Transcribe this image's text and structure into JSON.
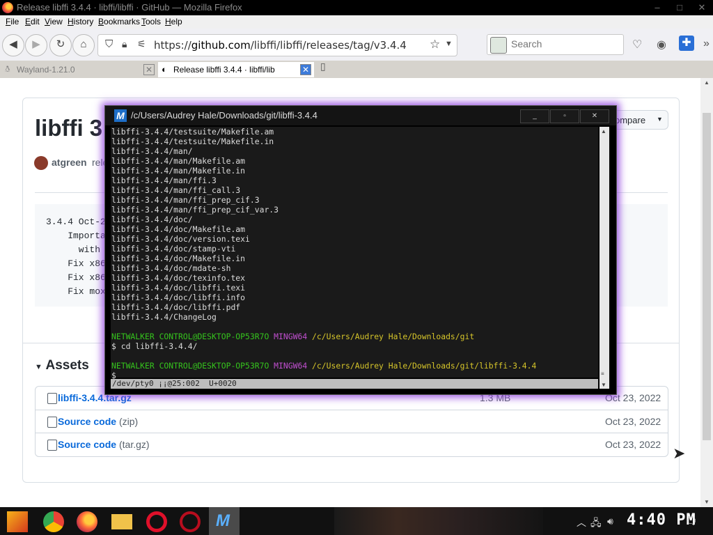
{
  "window": {
    "title": "Release libffi 3.4.4 · libffi/libffi · GitHub — Mozilla Firefox",
    "min_glyph": "–",
    "max_glyph": "□",
    "close_glyph": "✕"
  },
  "menu": [
    "File",
    "Edit",
    "View",
    "History",
    "Bookmarks",
    "Tools",
    "Help"
  ],
  "nav": {
    "url_prefix": "https://",
    "url_host": "github.com",
    "url_path": "/libffi/libffi/releases/tag/v3.4.4",
    "search_placeholder": "Search"
  },
  "tabs": [
    {
      "label": "Wayland-1.21.0",
      "active": false
    },
    {
      "label": "Release libffi 3.4.4 · libffi/lib",
      "active": true
    }
  ],
  "page": {
    "repo_title": "libffi 3",
    "author": "atgreen",
    "release_text": "rele",
    "compare_label": "ompare",
    "notes": [
      "3.4.4 Oct-2",
      "    Importa",
      "      with",
      "    Fix x86",
      "    Fix x86",
      "    Fix mox"
    ],
    "assets_title": "Assets",
    "assets": [
      {
        "name": "libffi-3.4.4.tar.gz",
        "ext": "",
        "size": "1.3 MB",
        "date": "Oct 23, 2022"
      },
      {
        "name": "Source code",
        "ext": "(zip)",
        "size": "",
        "date": "Oct 23, 2022"
      },
      {
        "name": "Source code",
        "ext": "(tar.gz)",
        "size": "",
        "date": "Oct 23, 2022"
      }
    ]
  },
  "terminal": {
    "title": "/c/Users/Audrey Hale/Downloads/git/libffi-3.4.4",
    "icon_letter": "M",
    "lines": [
      "libffi-3.4.4/testsuite/Makefile.am",
      "libffi-3.4.4/testsuite/Makefile.in",
      "libffi-3.4.4/man/",
      "libffi-3.4.4/man/Makefile.am",
      "libffi-3.4.4/man/Makefile.in",
      "libffi-3.4.4/man/ffi.3",
      "libffi-3.4.4/man/ffi_call.3",
      "libffi-3.4.4/man/ffi_prep_cif.3",
      "libffi-3.4.4/man/ffi_prep_cif_var.3",
      "libffi-3.4.4/doc/",
      "libffi-3.4.4/doc/Makefile.am",
      "libffi-3.4.4/doc/version.texi",
      "libffi-3.4.4/doc/stamp-vti",
      "libffi-3.4.4/doc/Makefile.in",
      "libffi-3.4.4/doc/mdate-sh",
      "libffi-3.4.4/doc/texinfo.tex",
      "libffi-3.4.4/doc/libffi.texi",
      "libffi-3.4.4/doc/libffi.info",
      "libffi-3.4.4/doc/libffi.pdf",
      "libffi-3.4.4/ChangeLog"
    ],
    "prompt1": {
      "user": "NETWALKER CONTROL@DESKTOP-OP53R7O",
      "env": "MINGW64",
      "path": "/c/Users/Audrey Hale/Downloads/git"
    },
    "cmd1": "$ cd libffi-3.4.4/",
    "prompt2": {
      "user": "NETWALKER CONTROL@DESKTOP-OP53R7O",
      "env": "MINGW64",
      "path": "/c/Users/Audrey Hale/Downloads/git/libffi-3.4.4"
    },
    "cmd2": "$",
    "status": "/dev/pty0 ¡¡@25:002  U+0020"
  },
  "taskbar": {
    "clock": "4:40 PM"
  },
  "colors": {
    "link": "#0969da",
    "term_green": "#35c41d",
    "term_purple": "#c14fd0",
    "term_yellow": "#d6c52a",
    "glow": "#8c3cdc"
  }
}
